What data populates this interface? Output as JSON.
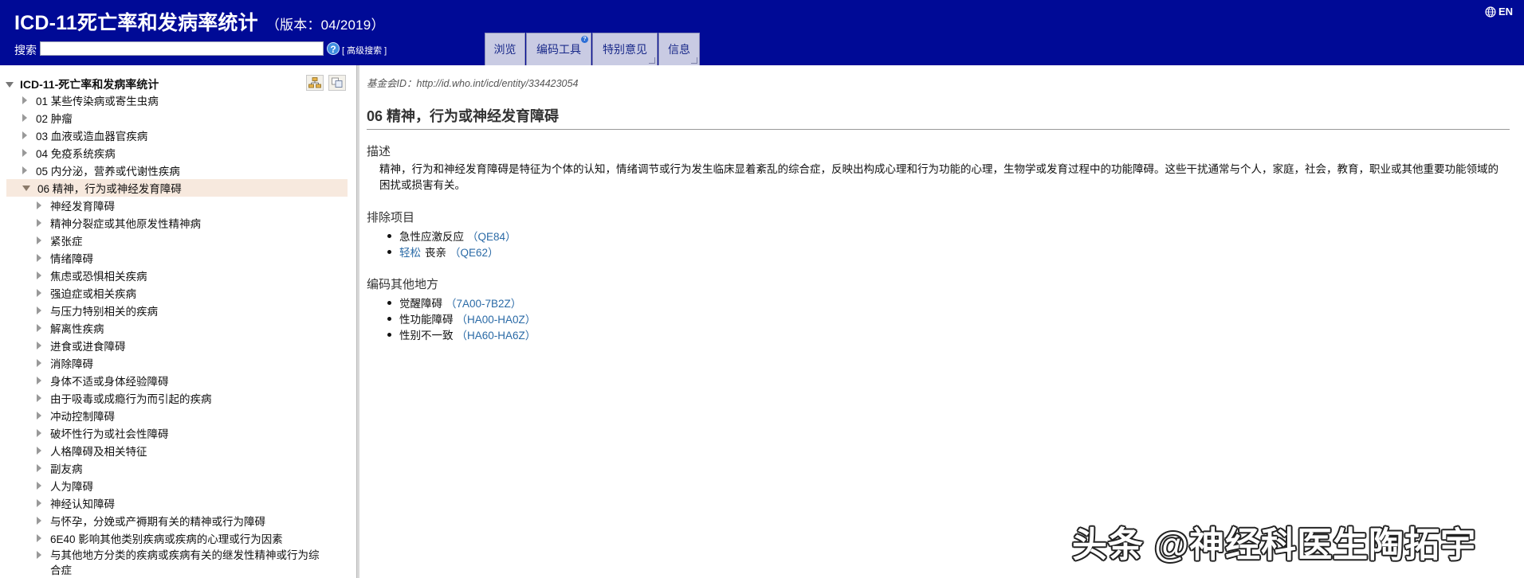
{
  "header": {
    "title": "ICD-11死亡率和发病率统计",
    "version": "（版本：04/2019）",
    "lang": "EN",
    "lang_icon": "globe-icon",
    "search_label": "搜索",
    "search_value": "",
    "help_icon": "?",
    "advanced_search": "[ 高级搜索 ]",
    "tabs": [
      {
        "label": "浏览"
      },
      {
        "label": "编码工具"
      },
      {
        "label": "特别意见"
      },
      {
        "label": "信息"
      }
    ],
    "tab_badge": "?",
    "bg_color": "#000a96"
  },
  "tree": {
    "root": "ICD-11-死亡率和发病率统计",
    "chapters": [
      "01 某些传染病或寄生虫病",
      "02 肿瘤",
      "03 血液或造血器官疾病",
      "04 免疫系统疾病",
      "05 内分泌，营养或代谢性疾病"
    ],
    "selected": "06 精神，行为或神经发育障碍",
    "children": [
      "神经发育障碍",
      "精神分裂症或其他原发性精神病",
      "紧张症",
      "情绪障碍",
      "焦虑或恐惧相关疾病",
      "强迫症或相关疾病",
      "与压力特别相关的疾病",
      "解离性疾病",
      "进食或进食障碍",
      "消除障碍",
      "身体不适或身体经验障碍",
      "由于吸毒或成瘾行为而引起的疾病",
      "冲动控制障碍",
      "破坏性行为或社会性障碍",
      "人格障碍及相关特征",
      "副友病",
      "人为障碍",
      "神经认知障碍",
      "与怀孕，分娩或产褥期有关的精神或行为障碍",
      "6E40 影响其他类别疾病或疾病的心理或行为因素",
      "与其他地方分类的疾病或疾病有关的继发性精神或行为综合症"
    ],
    "selected_bg": "#f7e9de"
  },
  "content": {
    "foundation_id": "基金会ID：http://id.who.int/icd/entity/334423054",
    "title": "06 精神，行为或神经发育障碍",
    "description_heading": "描述",
    "description": "精神，行为和神经发育障碍是特征为个体的认知，情绪调节或行为发生临床显着紊乱的综合症，反映出构成心理和行为功能的心理，生物学或发育过程中的功能障碍。这些干扰通常与个人，家庭，社会，教育，职业或其他重要功能领域的困扰或损害有关。",
    "exclusions_heading": "排除项目",
    "exclusions": [
      {
        "prefix": "",
        "text": "急性应激反应",
        "code": "（QE84）"
      },
      {
        "prefix": "轻松",
        "text": "丧亲",
        "code": "（QE62）"
      }
    ],
    "coded_elsewhere_heading": "编码其他地方",
    "coded_elsewhere": [
      {
        "text": "觉醒障碍",
        "code": "（7A00-7B2Z）"
      },
      {
        "text": "性功能障碍",
        "code": "（HA00-HA0Z）"
      },
      {
        "text": "性别不一致",
        "code": "（HA60-HA6Z）"
      }
    ],
    "link_color": "#2a6aa6"
  },
  "watermark": "头条 @神经科医生陶拓宇"
}
